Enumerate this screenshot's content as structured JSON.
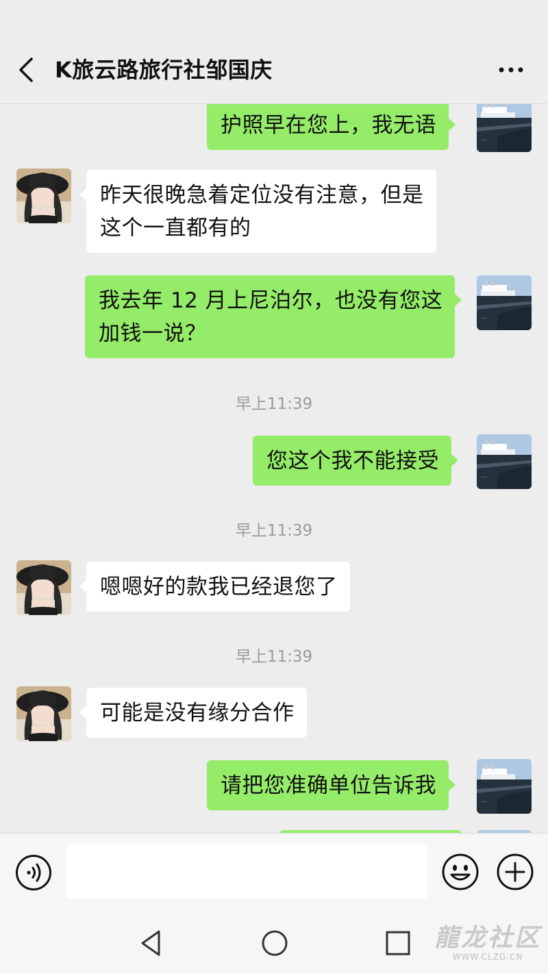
{
  "header": {
    "title": "K旅云路旅行社邹国庆",
    "back_icon": "chevron-left-icon",
    "more_icon": "more-dots-icon"
  },
  "messages": [
    {
      "direction": "out",
      "text": "护照早在您上，我无语"
    },
    {
      "direction": "in",
      "text": "昨天很晚急着定位没有注意，但是\n这个一直都有的"
    },
    {
      "direction": "out",
      "text": "我去年 12 月上尼泊尔，也没有您这\n加钱一说？"
    },
    {
      "type": "time",
      "text": "早上11:39"
    },
    {
      "direction": "out",
      "text": "您这个我不能接受"
    },
    {
      "type": "time",
      "text": "早上11:39"
    },
    {
      "direction": "in",
      "text": "嗯嗯好的款我已经退您了"
    },
    {
      "type": "time",
      "text": "早上11:39"
    },
    {
      "direction": "in",
      "text": "可能是没有缘分合作"
    },
    {
      "direction": "out",
      "text": "请把您准确单位告诉我"
    }
  ],
  "input_bar": {
    "voice_icon": "voice-icon",
    "input_value": "",
    "emoji_icon": "emoji-icon",
    "plus_icon": "plus-icon"
  },
  "navbar": {
    "back_icon": "triangle-back-icon",
    "home_icon": "circle-home-icon",
    "recent_icon": "square-recent-icon"
  },
  "watermark": {
    "main": "龍龙社区",
    "sub": "WWW.CLZG.CN"
  },
  "colors": {
    "outgoing_bubble": "#95ec69",
    "incoming_bubble": "#ffffff",
    "background": "#ededed"
  }
}
